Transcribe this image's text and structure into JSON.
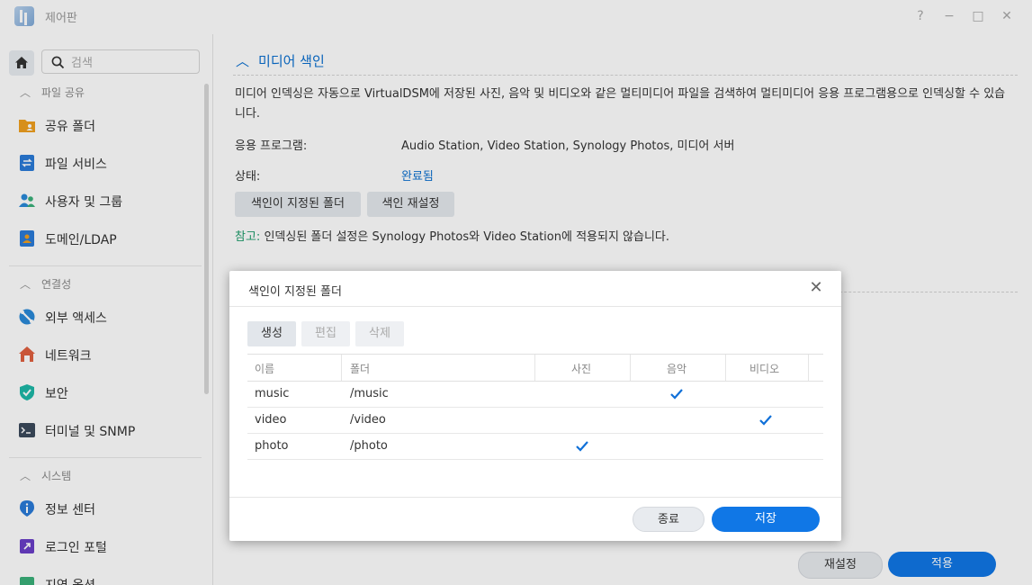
{
  "window": {
    "title": "제어판",
    "help": "?",
    "minimize": "−",
    "maximize": "□",
    "close": "✕"
  },
  "sidebar": {
    "search_placeholder": "검색",
    "sections": [
      {
        "label": "파일 공유",
        "items": [
          {
            "label": "공유 폴더",
            "icon": "shared-folder-icon"
          },
          {
            "label": "파일 서비스",
            "icon": "file-services-icon"
          },
          {
            "label": "사용자 및 그룹",
            "icon": "users-icon"
          },
          {
            "label": "도메인/LDAP",
            "icon": "domain-icon"
          }
        ]
      },
      {
        "label": "연결성",
        "items": [
          {
            "label": "외부 액세스",
            "icon": "external-access-icon"
          },
          {
            "label": "네트워크",
            "icon": "network-icon"
          },
          {
            "label": "보안",
            "icon": "security-shield-icon"
          },
          {
            "label": "터미널 및 SNMP",
            "icon": "terminal-icon"
          }
        ]
      },
      {
        "label": "시스템",
        "items": [
          {
            "label": "정보 센터",
            "icon": "info-icon"
          },
          {
            "label": "로그인 포털",
            "icon": "login-portal-icon"
          },
          {
            "label": "지역 옵션",
            "icon": "regional-icon"
          }
        ]
      }
    ]
  },
  "main": {
    "section_title": "미디어 색인",
    "description": "미디어 인덱싱은 자동으로 VirtualDSM에 저장된 사진, 음악 및 비디오와 같은 멀티미디어 파일을 검색하여 멀티미디어 응용 프로그램용으로 인덱싱할 수 있습니다.",
    "apps_label": "응용 프로그램:",
    "apps_value": "Audio Station, Video Station, Synology Photos, 미디어 서버",
    "status_label": "상태:",
    "status_value": "완료됨",
    "btn_indexed_folder": "색인이 지정된 폴더",
    "btn_reindex": "색인 재설정",
    "note_label": "참고:",
    "note_text": " 인덱싱된 폴더 설정은 Synology Photos와 Video Station에 적용되지 않습니다.",
    "reset_button": "재설정",
    "apply_button": "적용"
  },
  "dialog": {
    "title": "색인이 지정된 폴더",
    "toolbar": {
      "create": "생성",
      "edit": "편집",
      "delete": "삭제"
    },
    "columns": [
      "이름",
      "폴더",
      "사진",
      "음악",
      "비디오"
    ],
    "rows": [
      {
        "name": "music",
        "folder": "/music",
        "photo": false,
        "music": true,
        "video": false
      },
      {
        "name": "video",
        "folder": "/video",
        "photo": false,
        "music": false,
        "video": true
      },
      {
        "name": "photo",
        "folder": "/photo",
        "photo": true,
        "music": false,
        "video": false
      }
    ],
    "close_button": "종료",
    "save_button": "저장"
  },
  "colors": {
    "accent": "#1077e6",
    "link": "#0a6fd0",
    "note": "#1e9c6b"
  }
}
